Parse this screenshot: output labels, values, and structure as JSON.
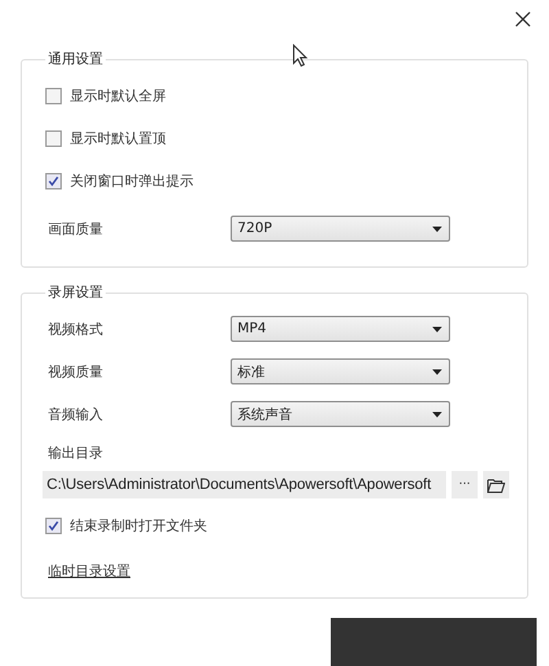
{
  "general": {
    "title": "通用设置",
    "checkboxes": [
      {
        "label": "显示时默认全屏",
        "checked": false
      },
      {
        "label": "显示时默认置顶",
        "checked": false
      },
      {
        "label": "关闭窗口时弹出提示",
        "checked": true
      }
    ],
    "quality": {
      "label": "画面质量",
      "value": "720P"
    }
  },
  "recording": {
    "title": "录屏设置",
    "selects": [
      {
        "label": "视频格式",
        "value": "MP4"
      },
      {
        "label": "视频质量",
        "value": "标准"
      },
      {
        "label": "音频输入",
        "value": "系统声音"
      }
    ],
    "output": {
      "label": "输出目录",
      "value": "C:\\Users\\Administrator\\Documents\\Apowersoft\\Apowersoft",
      "browse": "···"
    },
    "open_folder": {
      "label": "结束录制时打开文件夹",
      "checked": true
    },
    "temp_link": "临时目录设置"
  }
}
